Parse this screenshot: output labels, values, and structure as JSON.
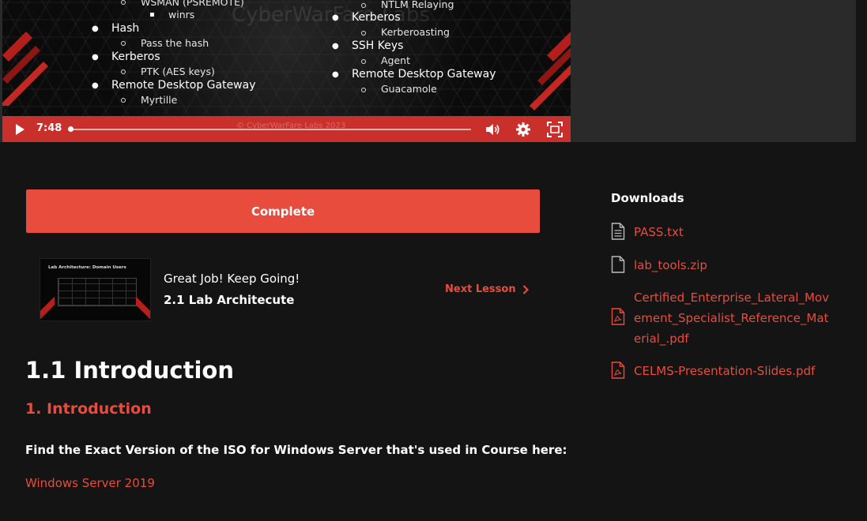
{
  "video": {
    "watermark": "CyberWarFare Labs",
    "copyright": "© CyberWarFare Labs 2023",
    "left_column": {
      "top_sub": "WSMAN (PSREMOTE)",
      "top_subsub": "winrs",
      "items": [
        {
          "label": "Hash",
          "sub": "Pass the hash"
        },
        {
          "label": "Kerberos",
          "sub": "PTK (AES keys)"
        },
        {
          "label": "Remote Desktop Gateway",
          "sub": "Myrtille"
        }
      ]
    },
    "right_column": {
      "top_sub": "NTLM Relaying",
      "items": [
        {
          "label": "Kerberos",
          "sub": "Kerberoasting"
        },
        {
          "label": "SSH Keys",
          "sub": "Agent"
        },
        {
          "label": "Remote Desktop Gateway",
          "sub": "Guacamole"
        }
      ]
    },
    "controls": {
      "time": "7:48",
      "progress": 0.0,
      "accent": "#c9302c"
    }
  },
  "main": {
    "complete_label": "Complete",
    "next": {
      "thumbnail_title": "Lab Architecture: Domain Users",
      "message": "Great Job! Keep Going!",
      "lesson_title": "2.1 Lab Architecute",
      "link_label": "Next Lesson"
    },
    "page_title": "1.1 Introduction",
    "section_heading": "1. Introduction",
    "find_text": "Find the Exact Version of the ISO for Windows Server that's used in Course here:",
    "iso_link": "Windows Server 2019"
  },
  "downloads": {
    "heading": "Downloads",
    "items": [
      {
        "name": "PASS.txt",
        "icon": "text-file-icon"
      },
      {
        "name": "lab_tools.zip",
        "icon": "file-icon"
      },
      {
        "name": "Certified_Enterprise_Lateral_Movement_Specialist_Reference_Material_.pdf",
        "icon": "pdf-file-icon"
      },
      {
        "name": "CELMS-Presentation-Slides.pdf",
        "icon": "pdf-file-icon"
      }
    ]
  },
  "colors": {
    "accent": "#e84c3d",
    "background": "#141414"
  }
}
